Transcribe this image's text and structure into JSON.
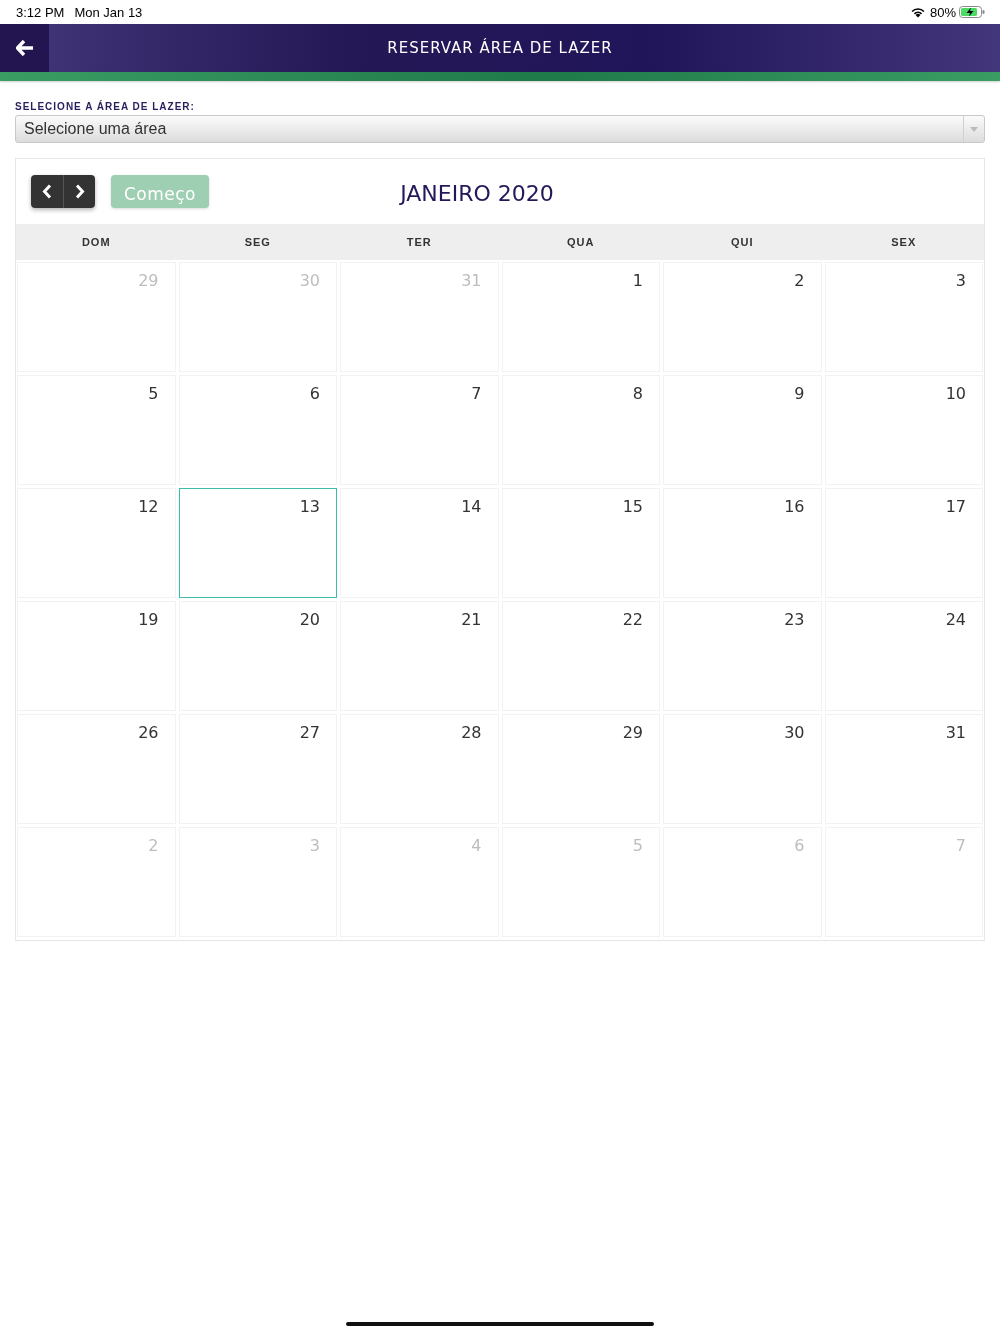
{
  "status_bar": {
    "time": "3:12 PM",
    "date": "Mon Jan 13",
    "battery": "80%"
  },
  "header": {
    "title": "RESERVAR ÁREA DE LAZER"
  },
  "area_select": {
    "label": "SELECIONE A ÁREA DE LAZER:",
    "value": "Selecione uma área"
  },
  "calendar": {
    "today_button": {
      "label": "Começo",
      "disabled": true
    },
    "title": "JANEIRO 2020",
    "weekdays": [
      "DOM",
      "SEG",
      "TER",
      "QUA",
      "QUI",
      "SEX"
    ],
    "weeks": [
      [
        {
          "day": "29",
          "other_month": true,
          "selected": false
        },
        {
          "day": "30",
          "other_month": true,
          "selected": false
        },
        {
          "day": "31",
          "other_month": true,
          "selected": false
        },
        {
          "day": "1",
          "other_month": false,
          "selected": false
        },
        {
          "day": "2",
          "other_month": false,
          "selected": false
        },
        {
          "day": "3",
          "other_month": false,
          "selected": false
        }
      ],
      [
        {
          "day": "5",
          "other_month": false,
          "selected": false
        },
        {
          "day": "6",
          "other_month": false,
          "selected": false
        },
        {
          "day": "7",
          "other_month": false,
          "selected": false
        },
        {
          "day": "8",
          "other_month": false,
          "selected": false
        },
        {
          "day": "9",
          "other_month": false,
          "selected": false
        },
        {
          "day": "10",
          "other_month": false,
          "selected": false
        }
      ],
      [
        {
          "day": "12",
          "other_month": false,
          "selected": false
        },
        {
          "day": "13",
          "other_month": false,
          "selected": true
        },
        {
          "day": "14",
          "other_month": false,
          "selected": false
        },
        {
          "day": "15",
          "other_month": false,
          "selected": false
        },
        {
          "day": "16",
          "other_month": false,
          "selected": false
        },
        {
          "day": "17",
          "other_month": false,
          "selected": false
        }
      ],
      [
        {
          "day": "19",
          "other_month": false,
          "selected": false
        },
        {
          "day": "20",
          "other_month": false,
          "selected": false
        },
        {
          "day": "21",
          "other_month": false,
          "selected": false
        },
        {
          "day": "22",
          "other_month": false,
          "selected": false
        },
        {
          "day": "23",
          "other_month": false,
          "selected": false
        },
        {
          "day": "24",
          "other_month": false,
          "selected": false
        }
      ],
      [
        {
          "day": "26",
          "other_month": false,
          "selected": false
        },
        {
          "day": "27",
          "other_month": false,
          "selected": false
        },
        {
          "day": "28",
          "other_month": false,
          "selected": false
        },
        {
          "day": "29",
          "other_month": false,
          "selected": false
        },
        {
          "day": "30",
          "other_month": false,
          "selected": false
        },
        {
          "day": "31",
          "other_month": false,
          "selected": false
        }
      ],
      [
        {
          "day": "2",
          "other_month": true,
          "selected": false
        },
        {
          "day": "3",
          "other_month": true,
          "selected": false
        },
        {
          "day": "4",
          "other_month": true,
          "selected": false
        },
        {
          "day": "5",
          "other_month": true,
          "selected": false
        },
        {
          "day": "6",
          "other_month": true,
          "selected": false
        },
        {
          "day": "7",
          "other_month": true,
          "selected": false
        }
      ]
    ]
  }
}
